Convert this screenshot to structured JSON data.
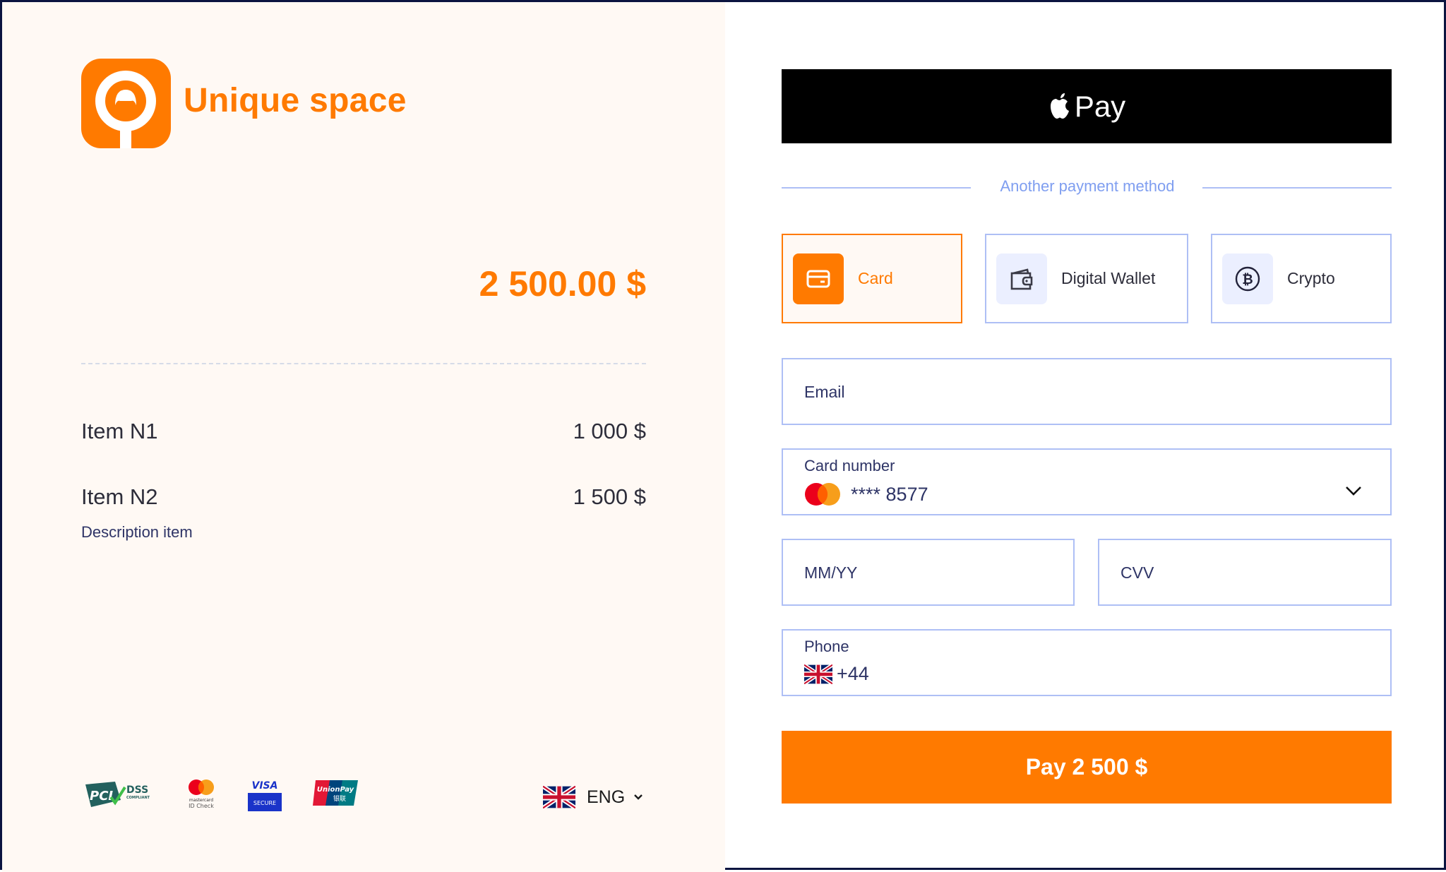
{
  "brand": {
    "name": "Unique space",
    "accent_color": "#ff7a00"
  },
  "order": {
    "total": "2 500.00 $",
    "items": [
      {
        "name": "Item N1",
        "amount": "1 000 $",
        "description": ""
      },
      {
        "name": "Item N2",
        "amount": "1 500 $",
        "description": "Description item"
      }
    ]
  },
  "footer": {
    "badges": [
      {
        "name": "PCI DSS Compliant",
        "icon": "pci-dss-icon",
        "text_main": "PCI",
        "text_sub": "DSS",
        "text_small": "COMPLIANT"
      },
      {
        "name": "Mastercard ID Check",
        "icon": "mastercard-id-check-icon",
        "text_main": "mastercard",
        "text_sub": "ID Check"
      },
      {
        "name": "Visa Secure",
        "icon": "visa-secure-icon",
        "text_main": "VISA",
        "text_sub": "SECURE"
      },
      {
        "name": "UnionPay",
        "icon": "unionpay-icon",
        "text_main": "UnionPay",
        "text_sub": "银联"
      }
    ],
    "language": {
      "flag": "uk-flag-icon",
      "label": "ENG",
      "chevron": "chevron-down-icon"
    }
  },
  "payment": {
    "apple_pay_label": "Pay",
    "apple_pay_icon": "apple-icon",
    "divider_text": "Another payment method",
    "methods": [
      {
        "label": "Card",
        "icon": "credit-card-icon",
        "active": true
      },
      {
        "label": "Digital Wallet",
        "icon": "wallet-icon",
        "active": false
      },
      {
        "label": "Crypto",
        "icon": "bitcoin-icon",
        "active": false
      }
    ],
    "fields": {
      "email": {
        "placeholder": "Email",
        "value": ""
      },
      "card_number": {
        "label": "Card number",
        "value": "**** 8577",
        "brand_icon": "mastercard-icon"
      },
      "expiry": {
        "placeholder": "MM/YY",
        "value": ""
      },
      "cvv": {
        "placeholder": "CVV",
        "value": ""
      },
      "phone": {
        "label": "Phone",
        "value": "+44",
        "flag": "uk-flag-icon"
      }
    },
    "pay_button_label": "Pay 2 500 $"
  },
  "colors": {
    "accent": "#ff7a00",
    "field_border": "#aebff5",
    "left_bg": "#fff9f4",
    "frame_border": "#0b1440"
  }
}
